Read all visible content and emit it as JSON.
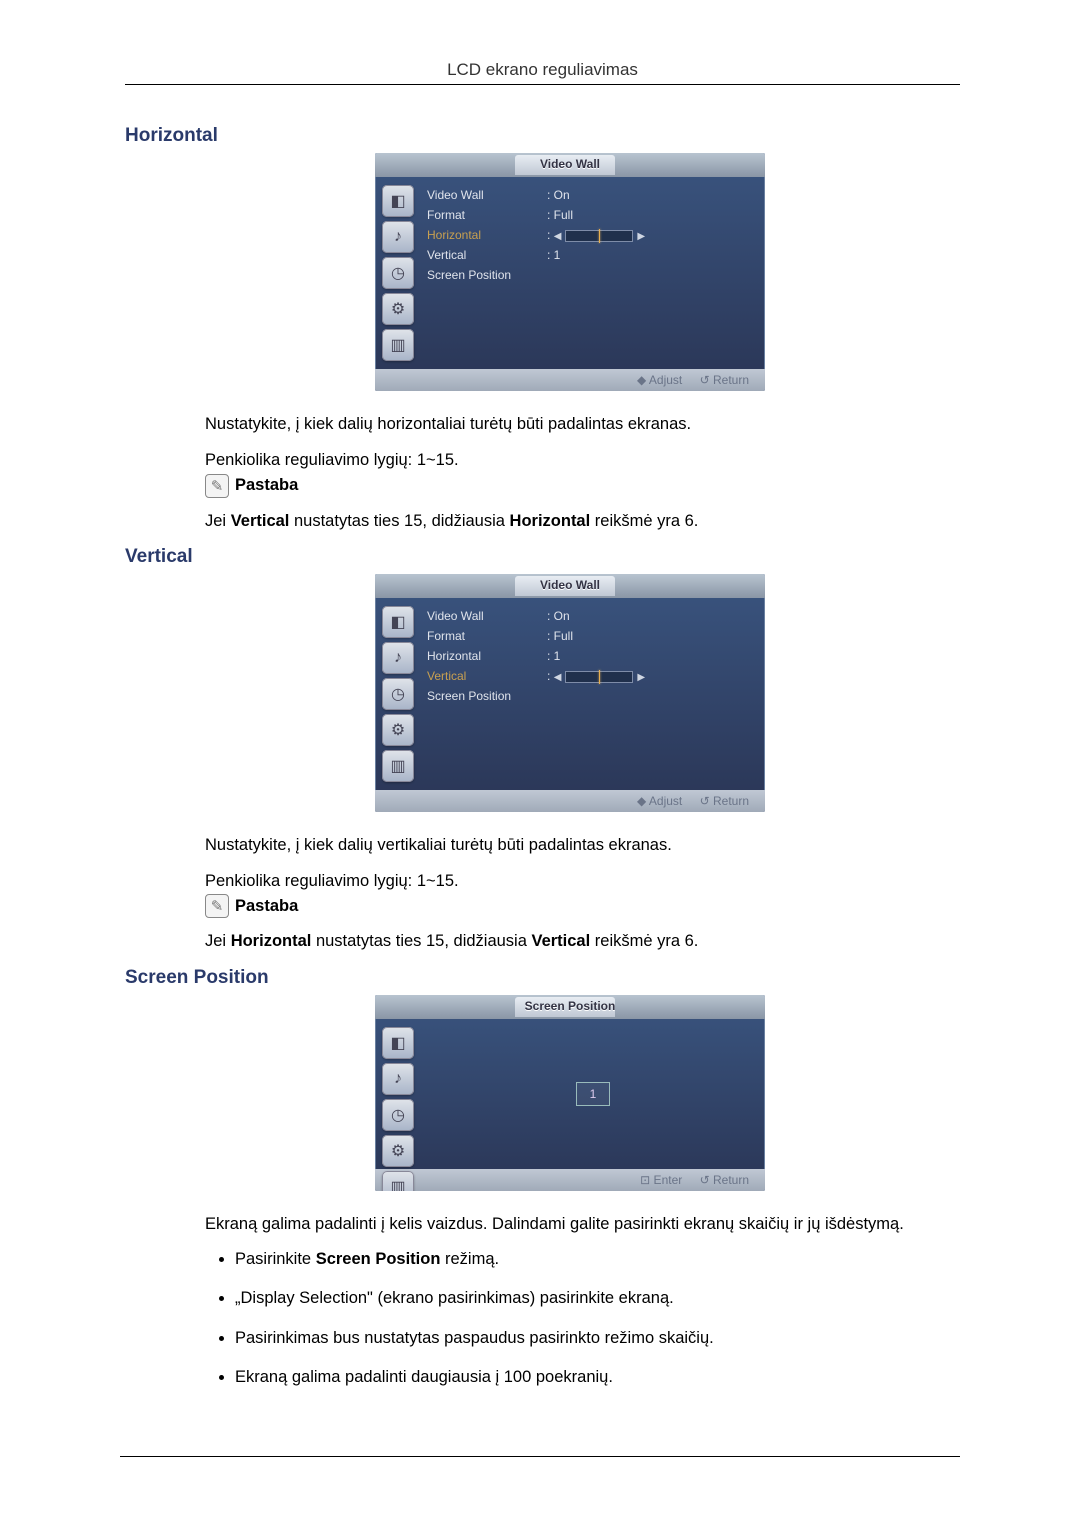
{
  "header": "LCD ekrano reguliavimas",
  "sections": {
    "horizontal": {
      "title": "Horizontal",
      "panel_title": "Video Wall",
      "rows": {
        "video_wall_label": "Video Wall",
        "video_wall_val": ": On",
        "format_label": "Format",
        "format_val": ": Full",
        "horizontal_label": "Horizontal",
        "horizontal_val": ":",
        "vertical_label": "Vertical",
        "vertical_val": ": 1",
        "screen_position_label": "Screen Position"
      },
      "footer_adjust": "◆ Adjust",
      "footer_return": "↺ Return",
      "desc1": "Nustatykite, į kiek dalių horizontaliai turėtų būti padalintas ekranas.",
      "desc2": "Penkiolika reguliavimo lygių: 1~15.",
      "note_label": "Pastaba",
      "note_text_pre": "Jei ",
      "note_b1": "Vertical",
      "note_mid": " nustatytas ties 15, didžiausia ",
      "note_b2": "Horizontal",
      "note_post": " reikšmė yra 6."
    },
    "vertical": {
      "title": "Vertical",
      "panel_title": "Video Wall",
      "rows": {
        "video_wall_label": "Video Wall",
        "video_wall_val": ": On",
        "format_label": "Format",
        "format_val": ": Full",
        "horizontal_label": "Horizontal",
        "horizontal_val": ": 1",
        "vertical_label": "Vertical",
        "vertical_val": ":",
        "screen_position_label": "Screen Position"
      },
      "footer_adjust": "◆ Adjust",
      "footer_return": "↺ Return",
      "desc1": "Nustatykite, į kiek dalių vertikaliai turėtų būti padalintas ekranas.",
      "desc2": "Penkiolika reguliavimo lygių: 1~15.",
      "note_label": "Pastaba",
      "note_text_pre": "Jei ",
      "note_b1": "Horizontal",
      "note_mid": " nustatytas ties 15, didžiausia ",
      "note_b2": "Vertical",
      "note_post": " reikšmė yra 6."
    },
    "screen_position": {
      "title": "Screen Position",
      "panel_title": "Screen Position",
      "box_val": "1",
      "footer_enter": "⊡ Enter",
      "footer_return": "↺ Return",
      "desc": "Ekraną galima padalinti į kelis vaizdus. Dalindami galite pasirinkti ekranų skaičių ir jų išdėstymą.",
      "bullets": [
        {
          "pre": "Pasirinkite ",
          "b": "Screen Position",
          "post": " režimą."
        },
        {
          "text": "„Display Selection\" (ekrano pasirinkimas) pasirinkite ekraną."
        },
        {
          "text": "Pasirinkimas bus nustatytas paspaudus pasirinkto režimo skaičių."
        },
        {
          "text": "Ekraną galima padalinti daugiausia į 100 poekranių."
        }
      ]
    }
  }
}
